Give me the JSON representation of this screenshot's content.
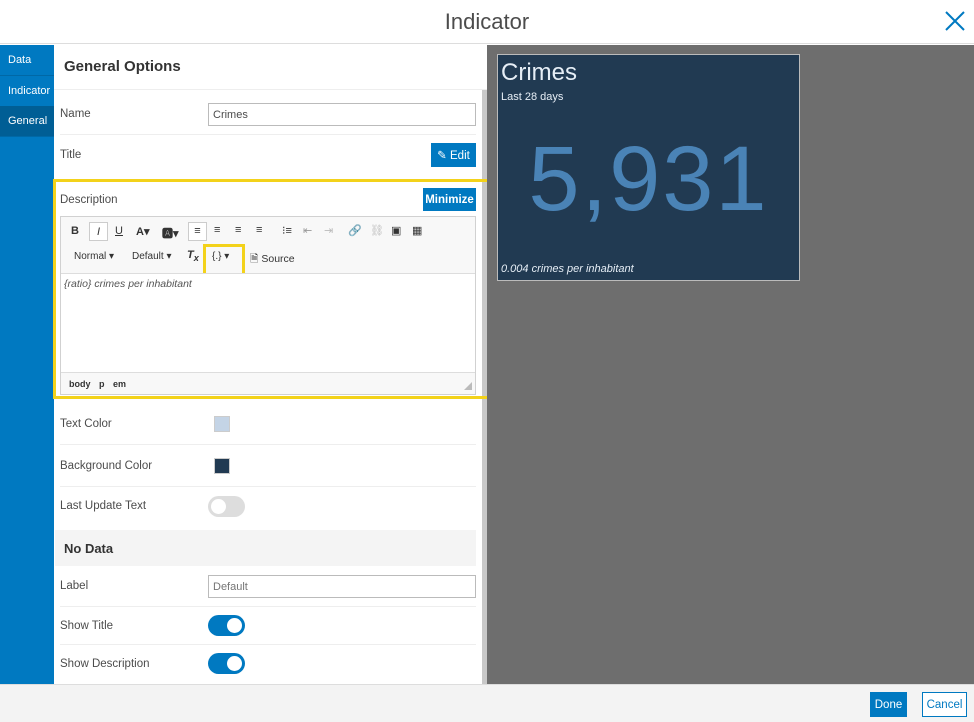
{
  "dialog": {
    "title": "Indicator"
  },
  "sidebar": {
    "items": [
      {
        "label": "Data"
      },
      {
        "label": "Indicator"
      },
      {
        "label": "General",
        "active": true
      }
    ]
  },
  "panel": {
    "heading": "General Options",
    "name": {
      "label": "Name",
      "value": "Crimes"
    },
    "title": {
      "label": "Title",
      "button": "Edit"
    },
    "description": {
      "label": "Description",
      "button": "Minimize",
      "toolbar": {
        "format": "Normal",
        "font": "Default",
        "placeholder_button": "{.}",
        "source": "Source"
      },
      "content": "{ratio} crimes per inhabitant",
      "path": [
        "body",
        "p",
        "em"
      ]
    },
    "text_color": {
      "label": "Text Color",
      "value": "#c4d4e6"
    },
    "background_color": {
      "label": "Background Color",
      "value": "#213a52"
    },
    "last_update": {
      "label": "Last Update Text",
      "on": false
    },
    "no_data": {
      "heading": "No Data",
      "label": {
        "label": "Label",
        "placeholder": "Default"
      },
      "show_title": {
        "label": "Show Title",
        "on": true
      },
      "show_description": {
        "label": "Show Description",
        "on": true
      }
    }
  },
  "preview": {
    "title": "Crimes",
    "subtitle": "Last 28 days",
    "value": "5,931",
    "description": "0.004 crimes per inhabitant"
  },
  "footer": {
    "done": "Done",
    "cancel": "Cancel"
  },
  "colors": {
    "accent": "#0079c1",
    "highlight": "#f3d21a",
    "card_bg": "#213a52",
    "value": "#4a83b6"
  }
}
